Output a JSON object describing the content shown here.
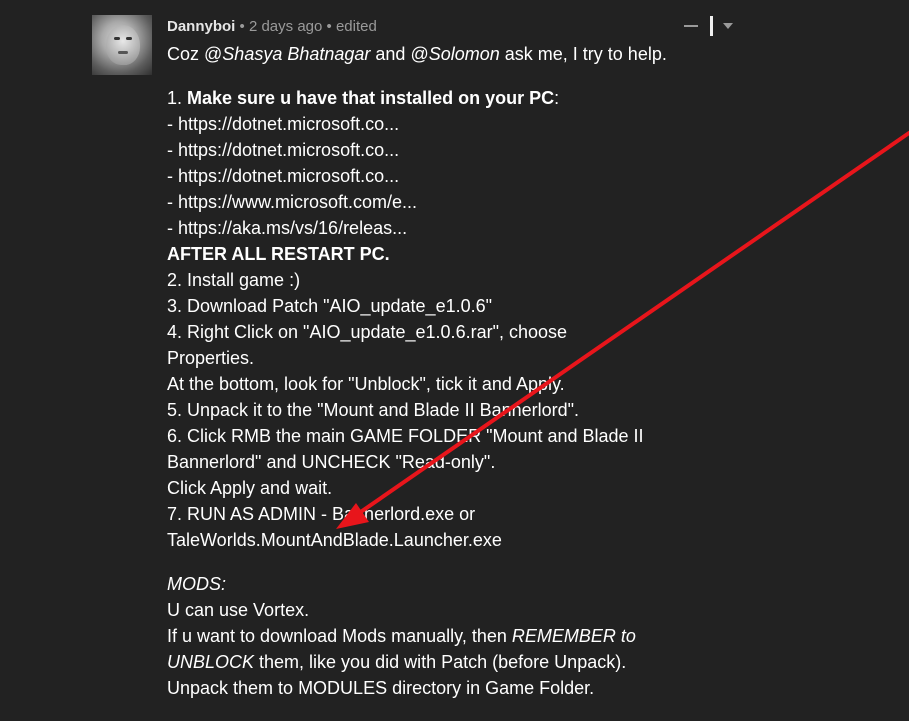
{
  "comment": {
    "author": "Dannyboi",
    "timestamp": "2 days ago",
    "edited_label": "edited",
    "bullet": "•",
    "intro": {
      "prefix": "Coz ",
      "mention1_at": "@",
      "mention1_name": "Shasya Bhatnagar",
      "mid": " and ",
      "mention2_at": "@",
      "mention2_name": "Solomon",
      "suffix": " ask me, I try to help."
    },
    "step1_num": "1. ",
    "step1_bold": "Make sure u have that installed on your PC",
    "step1_colon": ":",
    "links": [
      {
        "dash": "- ",
        "text": "https://dotnet.microsoft.co..."
      },
      {
        "dash": "- ",
        "text": "https://dotnet.microsoft.co..."
      },
      {
        "dash": "- ",
        "text": "https://dotnet.microsoft.co..."
      },
      {
        "dash": "- ",
        "text": "https://www.microsoft.com/e..."
      },
      {
        "dash": "- ",
        "text": "https://aka.ms/vs/16/releas..."
      }
    ],
    "after_restart": "AFTER ALL RESTART PC.",
    "steps": [
      "2. Install game :)",
      "3. Download Patch \"AIO_update_e1.0.6\"",
      "4. Right Click on \"AIO_update_e1.0.6.rar\", choose",
      "Properties.",
      "At the bottom, look for \"Unblock\", tick it and Apply.",
      "5. Unpack it to the \"Mount and Blade II Bannerlord\".",
      "6. Click RMB the main GAME FOLDER \"Mount and Blade II",
      "Bannerlord\" and UNCHECK \"Read-only\".",
      "Click Apply and wait.",
      "7. RUN AS ADMIN - Bannerlord.exe or",
      "TaleWorlds.MountAndBlade.Launcher.exe"
    ],
    "mods_heading": "MODS:",
    "mods_line1": "U can use Vortex.",
    "mods_line2_prefix": "If u want to download Mods manually, then ",
    "mods_line2_italic": "REMEMBER to",
    "mods_line3_italic": "UNBLOCK",
    "mods_line3_suffix": " them, like you did with Patch (before Unpack).",
    "mods_line4": "Unpack them to MODULES directory in Game Folder."
  },
  "annotation": {
    "arrow_color": "#e8151b"
  },
  "colors": {
    "background": "#222222",
    "text": "#ffffff",
    "meta": "#9a9a9a"
  }
}
